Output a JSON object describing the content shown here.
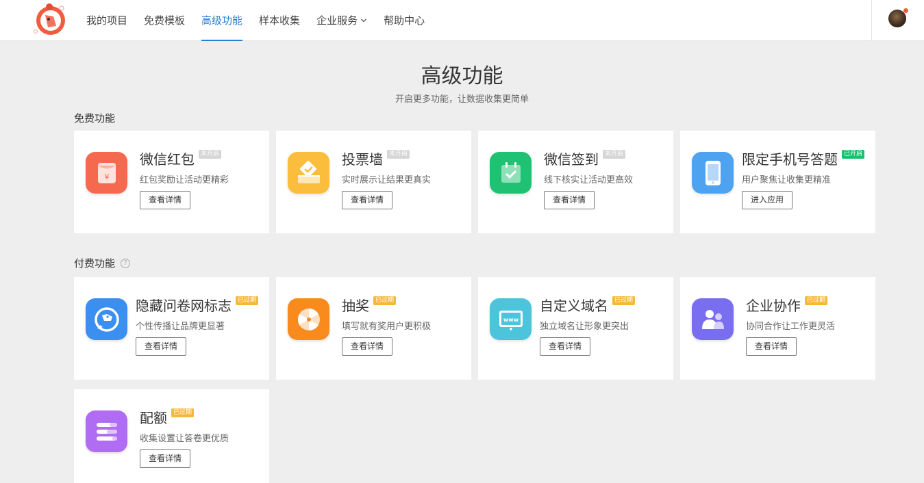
{
  "nav": {
    "items": [
      {
        "label": "我的项目"
      },
      {
        "label": "免费模板"
      },
      {
        "label": "高级功能"
      },
      {
        "label": "样本收集"
      },
      {
        "label": "企业服务"
      },
      {
        "label": "帮助中心"
      }
    ],
    "active_index": 2
  },
  "page": {
    "title": "高级功能",
    "subtitle": "开启更多功能，让数据收集更简单"
  },
  "free_section": {
    "title": "免费功能",
    "cards": [
      {
        "title": "微信红包",
        "badge": "未开启",
        "desc": "红包奖励让活动更精彩",
        "button": "查看详情",
        "icon": "red-envelope-icon",
        "color": "#f5694f"
      },
      {
        "title": "投票墙",
        "badge": "未开启",
        "desc": "实时展示让结果更真实",
        "button": "查看详情",
        "icon": "ballot-box-icon",
        "color": "#fbbd3c"
      },
      {
        "title": "微信签到",
        "badge": "未开启",
        "desc": "线下核实让活动更高效",
        "button": "查看详情",
        "icon": "calendar-check-icon",
        "color": "#1fc272"
      },
      {
        "title": "限定手机号答题",
        "badge": "已开启",
        "desc": "用户聚焦让收集更精准",
        "button": "进入应用",
        "icon": "mobile-phone-icon",
        "color": "#4da3f0"
      }
    ]
  },
  "paid_section": {
    "title": "付费功能",
    "help": "?",
    "cards": [
      {
        "title": "隐藏问卷网标志",
        "badge": "已过期",
        "desc": "个性传播让品牌更显著",
        "button": "查看详情",
        "icon": "rhino-logo-icon",
        "color": "#3b8ff0"
      },
      {
        "title": "抽奖",
        "badge": "已过期",
        "desc": "填写就有奖用户更积极",
        "button": "查看详情",
        "icon": "lottery-wheel-icon",
        "color": "#f98a1d"
      },
      {
        "title": "自定义域名",
        "badge": "已过期",
        "desc": "独立域名让形象更突出",
        "button": "查看详情",
        "icon": "www-screen-icon",
        "color": "#4bc4dc"
      },
      {
        "title": "企业协作",
        "badge": "已过期",
        "desc": "协同合作让工作更灵活",
        "button": "查看详情",
        "icon": "team-users-icon",
        "color": "#7a6ef0"
      },
      {
        "title": "配额",
        "badge": "已过期",
        "desc": "收集设置让答卷更优质",
        "button": "查看详情",
        "icon": "quota-bars-icon",
        "color": "#b06cf2"
      }
    ]
  }
}
